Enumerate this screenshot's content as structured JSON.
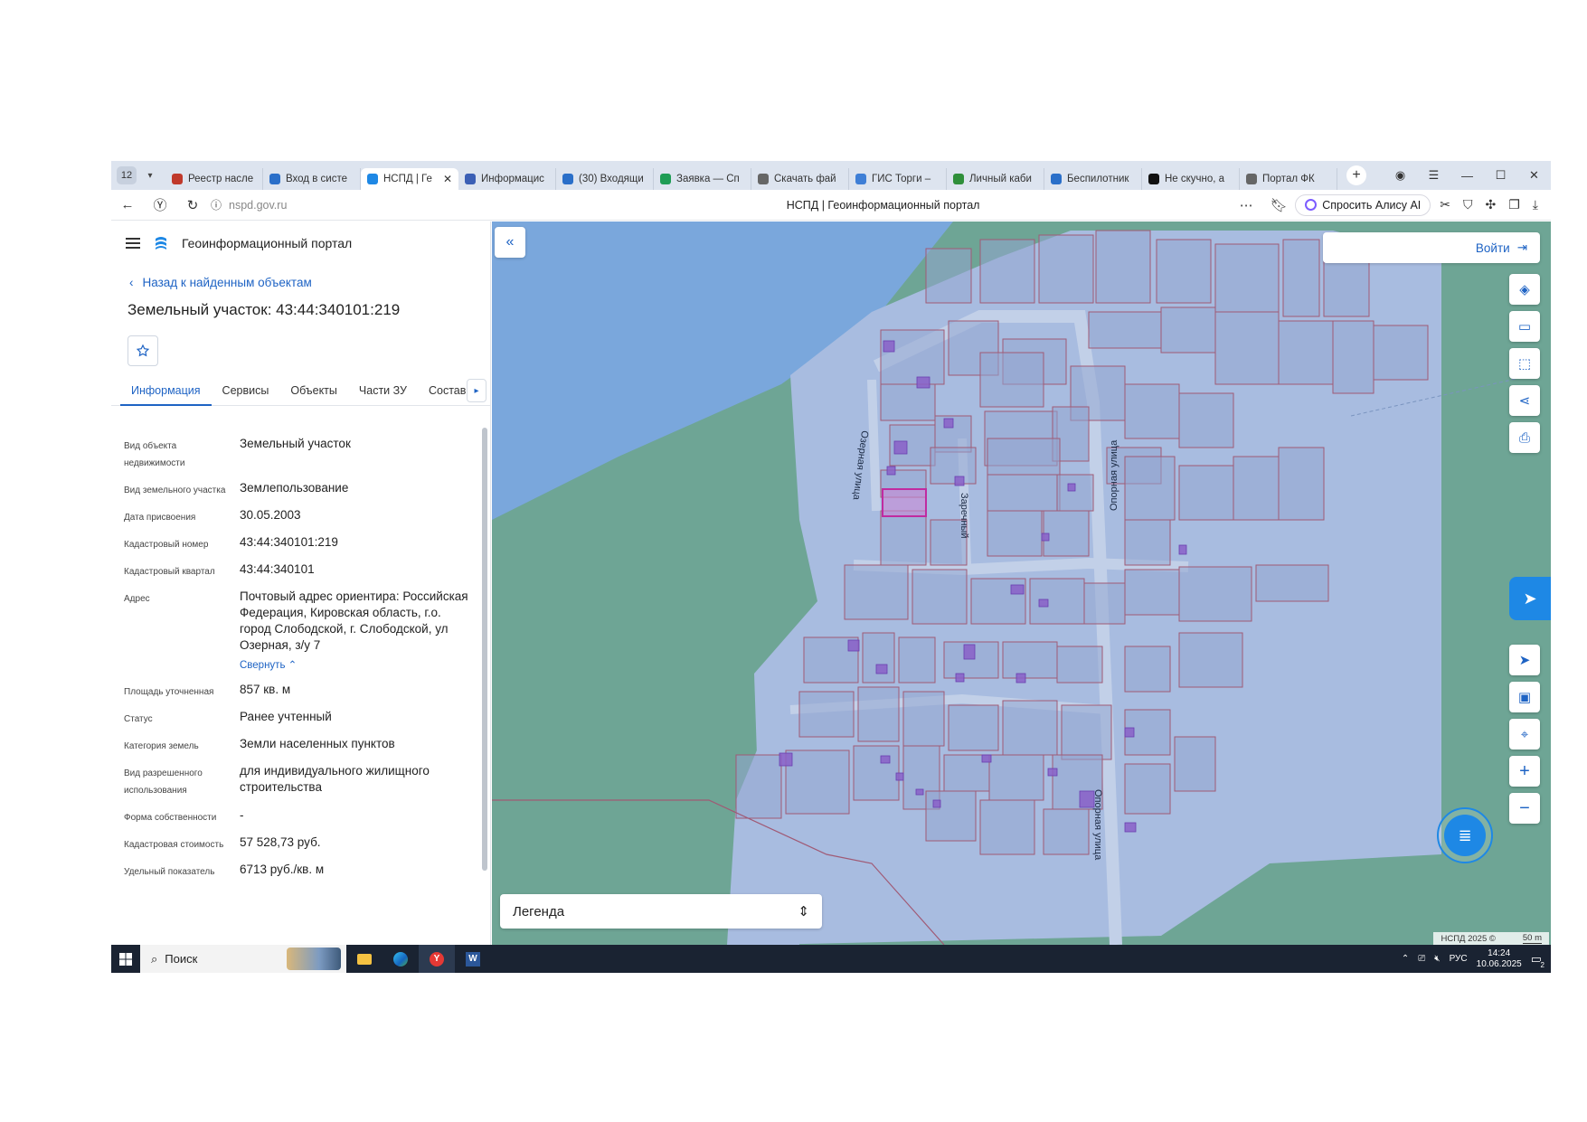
{
  "browser": {
    "tab_count": "12",
    "tabs": [
      {
        "label": "Реестр насле",
        "color": "#c0392b"
      },
      {
        "label": "Вход в систе",
        "color": "#2a6fc9"
      },
      {
        "label": "НСПД | Ге",
        "color": "#1e88e5",
        "active": true
      },
      {
        "label": "Информацис",
        "color": "#3b5fb5"
      },
      {
        "label": "(30) Входящи",
        "color": "#2a6fc9"
      },
      {
        "label": "Заявка — Сп",
        "color": "#1f9d55"
      },
      {
        "label": "Скачать фай",
        "color": "#666666"
      },
      {
        "label": "ГИС Торги – ",
        "color": "#3f7fd6"
      },
      {
        "label": "Личный каби",
        "color": "#2f8f3a"
      },
      {
        "label": "Беспилотник",
        "color": "#2a6fc9"
      },
      {
        "label": "Не скучно, а ",
        "color": "#111111"
      },
      {
        "label": "Портал ФК",
        "color": "#666666"
      }
    ],
    "url": "nspd.gov.ru",
    "page_title": "НСПД | Геоинформационный портал",
    "alice_label": "Спросить Алису AI"
  },
  "sidebar": {
    "portal_name": "Геоинформационный портал",
    "back_label": "Назад к найденным объектам",
    "title": "Земельный участок: 43:44:340101:219",
    "tabs": [
      "Информация",
      "Сервисы",
      "Объекты",
      "Части ЗУ",
      "Состав"
    ],
    "props": [
      {
        "key": "Вид объекта недвижимости",
        "value": "Земельный участок"
      },
      {
        "key": "Вид земельного участка",
        "value": "Землепользование"
      },
      {
        "key": "Дата присвоения",
        "value": "30.05.2003"
      },
      {
        "key": "Кадастровый номер",
        "value": "43:44:340101:219"
      },
      {
        "key": "Кадастровый квартал",
        "value": "43:44:340101"
      },
      {
        "key": "Адрес",
        "value": "Почтовый адрес ориентира: Российская Федерация, Кировская область, г.о. город Слободской, г. Слободской, ул Озерная, з/у 7",
        "link": "Свернуть"
      },
      {
        "key": "Площадь уточненная",
        "value": "857 кв. м"
      },
      {
        "key": "Статус",
        "value": "Ранее учтенный"
      },
      {
        "key": "Категория земель",
        "value": "Земли населенных пунктов"
      },
      {
        "key": "Вид разрешенного использования",
        "value": "для индивидуального жилищного строительства"
      },
      {
        "key": "Форма собственности",
        "value": "-"
      },
      {
        "key": "Кадастровая стоимость",
        "value": "57 528,73 руб."
      },
      {
        "key": "Удельный показатель",
        "value": "6713 руб./кв. м"
      }
    ]
  },
  "map": {
    "login_label": "Войти",
    "legend_label": "Легенда",
    "streets": [
      "Озерная улица",
      "Заречный",
      "Опорная улица",
      "Опорная улица"
    ],
    "copyright": "НСПД 2025 ©",
    "scale": "50 m",
    "colors": {
      "water": "#7aa7dc",
      "green": "#6ea595",
      "parcel_fill": "#a8bce0",
      "parcel_stroke": "#a05a75",
      "building": "#8a60c8",
      "selected": "#c02ba0"
    }
  },
  "taskbar": {
    "search_label": "Поиск",
    "lang": "РУС",
    "time": "14:24",
    "date": "10.06.2025",
    "notif_count": "2"
  }
}
